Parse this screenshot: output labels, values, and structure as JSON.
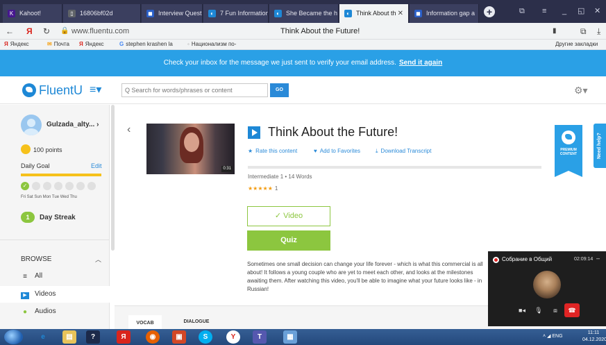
{
  "browser": {
    "tabs": [
      {
        "label": "Kahoot!",
        "color": "#46178f",
        "glyph": "K"
      },
      {
        "label": "16806bf02d",
        "color": "#5f6368",
        "glyph": "▯"
      },
      {
        "label": "Interview Questio",
        "color": "#2a5fc7",
        "glyph": "◼"
      },
      {
        "label": "7 Fun Information",
        "color": "#1e88d6",
        "glyph": "◐"
      },
      {
        "label": "She Became the h",
        "color": "#1e88d6",
        "glyph": "◐"
      },
      {
        "label": "Think About th",
        "color": "#1e88d6",
        "glyph": "◐",
        "active": true
      },
      {
        "label": "Information gap a",
        "color": "#2a5fc7",
        "glyph": "◼"
      }
    ],
    "url": "www.fluentu.com",
    "page_title": "Think About the Future!",
    "bookmarks": [
      "Яндекс",
      "Почта",
      "Яндекс",
      "stephen krashen la",
      "Национализм по-"
    ],
    "other_bookmarks": "Другие закладки"
  },
  "banner": {
    "text": "Check your inbox for the message we just sent to verify your email address.",
    "link": "Send it again"
  },
  "header": {
    "logo": "FluentU",
    "search_placeholder": "Q Search for words/phrases or content",
    "search_button": "GO"
  },
  "sidebar": {
    "username": "Gulzada_alty...",
    "points": "100 points",
    "daily_goal": "Daily Goal",
    "edit": "Edit",
    "days": "Fri  Sat  Sun Mon Tue Wed Thu",
    "streak_count": "1",
    "streak_label": "Day Streak",
    "browse": "BROWSE",
    "items": [
      {
        "label": "All",
        "icon": "list-icon"
      },
      {
        "label": "Videos",
        "icon": "video-icon"
      },
      {
        "label": "Audios",
        "icon": "audio-icon"
      }
    ]
  },
  "content": {
    "duration": "0:31",
    "title": "Think About the Future!",
    "actions": {
      "rate": "Rate this content",
      "favorite": "Add to Favorites",
      "download": "Download Transcript"
    },
    "level": "Intermediate 1",
    "separator": "•",
    "words": "14 Words",
    "stars": "★★★★★",
    "rating_count": "1",
    "video_label": "✓ Video",
    "quiz_label": "Quiz",
    "description": "Sometimes one small decision can change your life forever - which is what this commercial is all about! It follows a young couple who are yet to meet each other, and looks at the milestones awaiting them. After watching this video, you'll be able to imagine what your future looks like - in Russian!",
    "premium": "PREMIUM CONTENT",
    "need_help": "Need help?",
    "tabs": [
      "VOCAB",
      "DIALOGUE"
    ]
  },
  "call": {
    "title": "Собрание в Общий",
    "time": "02:09:14"
  },
  "taskbar": {
    "lang": "ENG",
    "time": "11:11",
    "date": "04.12.2020"
  },
  "colors": {
    "accent": "#1e88d6",
    "banner": "#2aa0e6",
    "green": "#8cc63f",
    "gold": "#f6c11b"
  }
}
